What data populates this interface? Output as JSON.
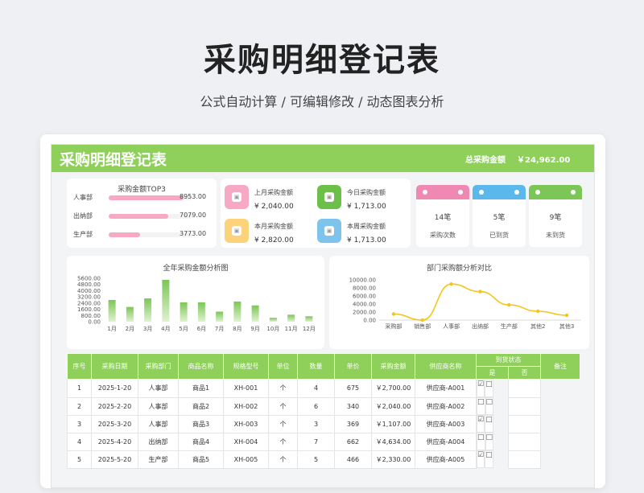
{
  "header": {
    "title": "采购明细登记表",
    "subtitle": "公式自动计算 /  可编辑修改  / 动态图表分析"
  },
  "sheet": {
    "title": "采购明细登记表",
    "total_label": "总采购金额",
    "total_value": "￥24,962.00"
  },
  "top3": {
    "title": "采购金额TOP3",
    "items": [
      {
        "name": "人事部",
        "value": 8953.0,
        "value_text": "8953.00"
      },
      {
        "name": "出纳部",
        "value": 7079.0,
        "value_text": "7079.00"
      },
      {
        "name": "生产部",
        "value": 3773.0,
        "value_text": "3773.00"
      }
    ],
    "max": 10000
  },
  "mini_stats": {
    "last_month_label": "上月采购金额",
    "last_month_value": "¥ 2,040.00",
    "this_month_label": "本月采购金额",
    "this_month_value": "¥ 2,820.00",
    "today_label": "今日采购金额",
    "today_value": "¥ 1,713.00",
    "this_week_label": "本周采购金额",
    "this_week_value": "¥ 1,713.00",
    "colors": {
      "pink": "#f7a8c4",
      "yellow": "#fcd27a",
      "green": "#6cc04a",
      "blue": "#7ec3ec"
    }
  },
  "stat_cards": [
    {
      "value": "14笔",
      "label": "采购次数",
      "color": "#f088b4"
    },
    {
      "value": "5笔",
      "label": "已到货",
      "color": "#5bb8ea"
    },
    {
      "value": "9笔",
      "label": "未到货",
      "color": "#7cc657"
    }
  ],
  "chart_data": [
    {
      "type": "bar",
      "title": "全年采购金额分析图",
      "categories": [
        "1月",
        "2月",
        "3月",
        "4月",
        "5月",
        "6月",
        "7月",
        "8月",
        "9月",
        "10月",
        "11月",
        "12月"
      ],
      "values": [
        2800,
        1900,
        3000,
        5400,
        2500,
        2500,
        1300,
        2600,
        2100,
        500,
        900,
        700
      ],
      "ylim": [
        0,
        5600
      ],
      "yticks": [
        "5600.00",
        "4800.00",
        "4000.00",
        "3200.00",
        "2400.00",
        "1600.00",
        "800.00",
        "0.00"
      ],
      "color": "#7cc657"
    },
    {
      "type": "line",
      "title": "部门采购额分析对比",
      "categories": [
        "采购部",
        "销售部",
        "人事部",
        "出纳部",
        "生产部",
        "其他2",
        "其他3"
      ],
      "values": [
        1500,
        0,
        8953,
        7079,
        3773,
        2200,
        1200
      ],
      "ylim": [
        0,
        10000
      ],
      "yticks": [
        "10000.00",
        "8000.00",
        "6000.00",
        "4000.00",
        "2000.00",
        "0.00"
      ],
      "color": "#f5c518"
    }
  ],
  "table": {
    "headers": [
      "序号",
      "采购日期",
      "采购部门",
      "商品名称",
      "规格型号",
      "单位",
      "数量",
      "单价",
      "采购金额",
      "供应商名称",
      "到货状态",
      "备注"
    ],
    "sub_headers": [
      "是",
      "否"
    ],
    "rows": [
      {
        "no": "1",
        "date": "2025-1-20",
        "dept": "人事部",
        "product": "商品1",
        "spec": "XH-001",
        "unit": "个",
        "qty": "4",
        "price": "675",
        "amount": "￥2,700.00",
        "supplier": "供应商-A001",
        "yes": "☑",
        "no_mark": "□",
        "remark": ""
      },
      {
        "no": "2",
        "date": "2025-2-20",
        "dept": "人事部",
        "product": "商品2",
        "spec": "XH-002",
        "unit": "个",
        "qty": "6",
        "price": "340",
        "amount": "￥2,040.00",
        "supplier": "供应商-A002",
        "yes": "□",
        "no_mark": "□",
        "remark": ""
      },
      {
        "no": "3",
        "date": "2025-3-20",
        "dept": "人事部",
        "product": "商品3",
        "spec": "XH-003",
        "unit": "个",
        "qty": "3",
        "price": "369",
        "amount": "￥1,107.00",
        "supplier": "供应商-A003",
        "yes": "☑",
        "no_mark": "□",
        "remark": ""
      },
      {
        "no": "4",
        "date": "2025-4-20",
        "dept": "出纳部",
        "product": "商品4",
        "spec": "XH-004",
        "unit": "个",
        "qty": "7",
        "price": "662",
        "amount": "￥4,634.00",
        "supplier": "供应商-A004",
        "yes": "□",
        "no_mark": "□",
        "remark": ""
      },
      {
        "no": "5",
        "date": "2025-5-20",
        "dept": "生产部",
        "product": "商品5",
        "spec": "XH-005",
        "unit": "个",
        "qty": "5",
        "price": "466",
        "amount": "￥2,330.00",
        "supplier": "供应商-A005",
        "yes": "☑",
        "no_mark": "□",
        "remark": ""
      }
    ]
  }
}
